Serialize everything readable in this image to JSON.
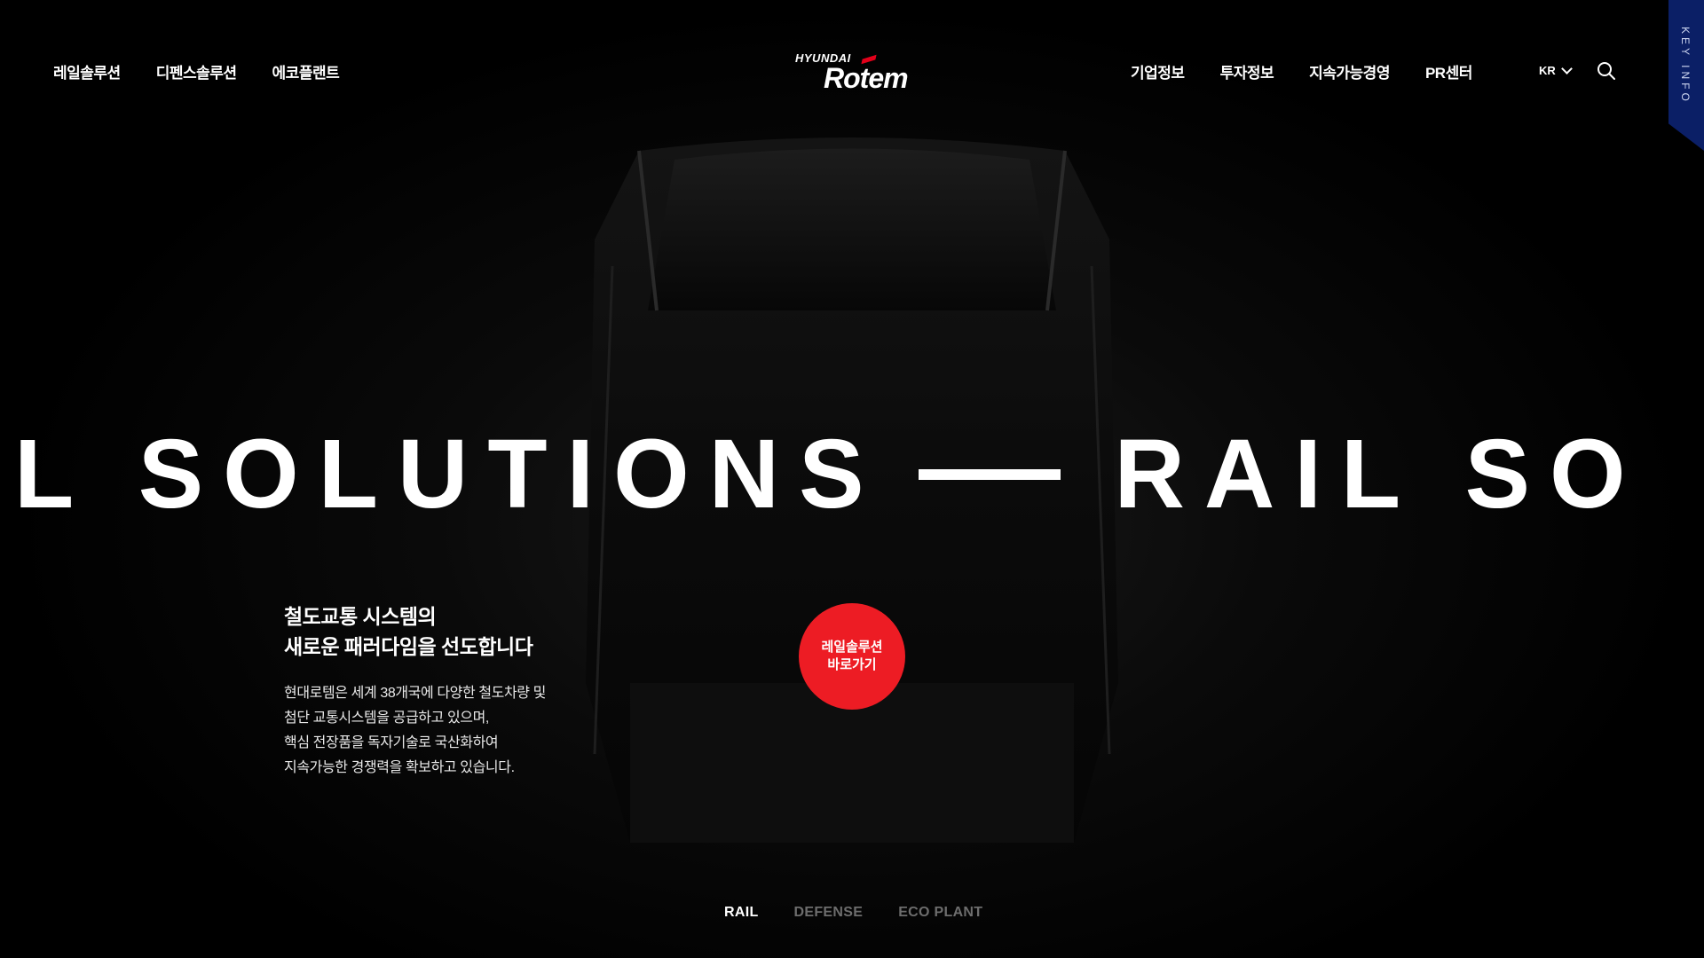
{
  "header": {
    "nav_left": [
      "레일솔루션",
      "디펜스솔루션",
      "에코플랜트"
    ],
    "nav_right": [
      "기업정보",
      "투자정보",
      "지속가능경영",
      "PR센터"
    ],
    "logo": {
      "top": "HYUNDAI",
      "main": "Rotem"
    },
    "language": "KR",
    "search_icon": "search-icon",
    "key_info": "KEY INFO"
  },
  "hero": {
    "marquee": "AIL SOLUTIONS",
    "marquee_repeat": "RAIL SO",
    "headline_line1": "철도교통 시스템의",
    "headline_line2": "새로운 패러다임을 선도합니다",
    "body_line1": "현대로템은 세계 38개국에 다양한 철도차량 및",
    "body_line2": "첨단 교통시스템을 공급하고 있으며,",
    "body_line3": "핵심 전장품을 독자기술로 국산화하여",
    "body_line4": "지속가능한 경쟁력을 확보하고 있습니다.",
    "cta_line1": "레일솔루션",
    "cta_line2": "바로가기"
  },
  "tabs": [
    {
      "label": "RAIL",
      "active": true
    },
    {
      "label": "DEFENSE",
      "active": false
    },
    {
      "label": "ECO PLANT",
      "active": false
    }
  ],
  "colors": {
    "accent": "#ed1c24",
    "key_info_bg": "#0b1f66",
    "background": "#000000"
  }
}
